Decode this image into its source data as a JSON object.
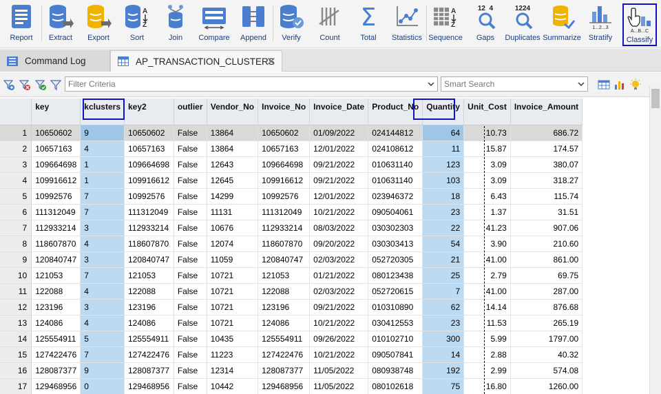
{
  "toolbar": {
    "buttons": [
      {
        "label": "Report",
        "icon": "report-icon"
      },
      {
        "label": "Extract",
        "icon": "extract-icon"
      },
      {
        "label": "Export",
        "icon": "export-icon"
      },
      {
        "label": "Sort",
        "icon": "sort-icon",
        "glyph_a": "A",
        "glyph_z": "Z"
      },
      {
        "label": "Join",
        "icon": "join-icon"
      },
      {
        "label": "Compare",
        "icon": "compare-icon"
      },
      {
        "label": "Append",
        "icon": "append-icon"
      },
      {
        "label": "Verify",
        "icon": "verify-icon"
      },
      {
        "label": "Count",
        "icon": "count-icon"
      },
      {
        "label": "Total",
        "icon": "total-icon",
        "glyph": "Σ"
      },
      {
        "label": "Statistics",
        "icon": "statistics-icon"
      },
      {
        "label": "Sequence",
        "icon": "sequence-icon",
        "glyph_a": "A",
        "glyph_z": "Z"
      },
      {
        "label": "Gaps",
        "icon": "gaps-icon",
        "glyph": "12  4"
      },
      {
        "label": "Duplicates",
        "icon": "duplicates-icon",
        "glyph": "1224"
      },
      {
        "label": "Summarize",
        "icon": "summarize-icon"
      },
      {
        "label": "Stratify",
        "icon": "stratify-icon",
        "glyph": "1...2...3"
      },
      {
        "label": "Classify",
        "icon": "classify-icon",
        "glyph": "A...B...C"
      }
    ]
  },
  "tabs": {
    "command_log": "Command Log",
    "table": "AP_TRANSACTION_CLUSTERS",
    "close_glyph": "✕"
  },
  "filter": {
    "placeholder": "Filter Criteria",
    "smart_search_placeholder": "Smart Search"
  },
  "colors": {
    "highlight_column": "#bcdaf2",
    "annotation_box": "#1010c8",
    "toolbar_icon": "#4a7fd0"
  },
  "grid": {
    "columns": [
      "key",
      "kclusters",
      "key2",
      "outlier",
      "Vendor_No",
      "Invoice_No",
      "Invoice_Date",
      "Product_No",
      "Quantity",
      "Unit_Cost",
      "Invoice_Amount"
    ],
    "rows": [
      [
        "1",
        "10650602",
        "9",
        "10650602",
        "False",
        "13864",
        "10650602",
        "01/09/2022",
        "024144812",
        "64",
        "10.73",
        "686.72"
      ],
      [
        "2",
        "10657163",
        "4",
        "10657163",
        "False",
        "13864",
        "10657163",
        "12/01/2022",
        "024108612",
        "11",
        "15.87",
        "174.57"
      ],
      [
        "3",
        "109664698",
        "1",
        "109664698",
        "False",
        "12643",
        "109664698",
        "09/21/2022",
        "010631140",
        "123",
        "3.09",
        "380.07"
      ],
      [
        "4",
        "109916612",
        "1",
        "109916612",
        "False",
        "12645",
        "109916612",
        "09/21/2022",
        "010631140",
        "103",
        "3.09",
        "318.27"
      ],
      [
        "5",
        "10992576",
        "7",
        "10992576",
        "False",
        "14299",
        "10992576",
        "12/01/2022",
        "023946372",
        "18",
        "6.43",
        "115.74"
      ],
      [
        "6",
        "111312049",
        "7",
        "111312049",
        "False",
        "11131",
        "111312049",
        "10/21/2022",
        "090504061",
        "23",
        "1.37",
        "31.51"
      ],
      [
        "7",
        "112933214",
        "3",
        "112933214",
        "False",
        "10676",
        "112933214",
        "08/03/2022",
        "030302303",
        "22",
        "41.23",
        "907.06"
      ],
      [
        "8",
        "118607870",
        "4",
        "118607870",
        "False",
        "12074",
        "118607870",
        "09/20/2022",
        "030303413",
        "54",
        "3.90",
        "210.60"
      ],
      [
        "9",
        "120840747",
        "3",
        "120840747",
        "False",
        "11059",
        "120840747",
        "02/03/2022",
        "052720305",
        "21",
        "41.00",
        "861.00"
      ],
      [
        "10",
        "121053",
        "7",
        "121053",
        "False",
        "10721",
        "121053",
        "01/21/2022",
        "080123438",
        "25",
        "2.79",
        "69.75"
      ],
      [
        "11",
        "122088",
        "4",
        "122088",
        "False",
        "10721",
        "122088",
        "02/03/2022",
        "052720615",
        "7",
        "41.00",
        "287.00"
      ],
      [
        "12",
        "123196",
        "3",
        "123196",
        "False",
        "10721",
        "123196",
        "09/21/2022",
        "010310890",
        "62",
        "14.14",
        "876.68"
      ],
      [
        "13",
        "124086",
        "4",
        "124086",
        "False",
        "10721",
        "124086",
        "10/21/2022",
        "030412553",
        "23",
        "11.53",
        "265.19"
      ],
      [
        "14",
        "125554911",
        "5",
        "125554911",
        "False",
        "10435",
        "125554911",
        "09/26/2022",
        "010102710",
        "300",
        "5.99",
        "1797.00"
      ],
      [
        "15",
        "127422476",
        "7",
        "127422476",
        "False",
        "11223",
        "127422476",
        "10/21/2022",
        "090507841",
        "14",
        "2.88",
        "40.32"
      ],
      [
        "16",
        "128087377",
        "9",
        "128087377",
        "False",
        "12314",
        "128087377",
        "11/05/2022",
        "080938748",
        "192",
        "2.99",
        "574.08"
      ],
      [
        "17",
        "129468956",
        "0",
        "129468956",
        "False",
        "10442",
        "129468956",
        "11/05/2022",
        "080102618",
        "75",
        "16.80",
        "1260.00"
      ]
    ]
  }
}
